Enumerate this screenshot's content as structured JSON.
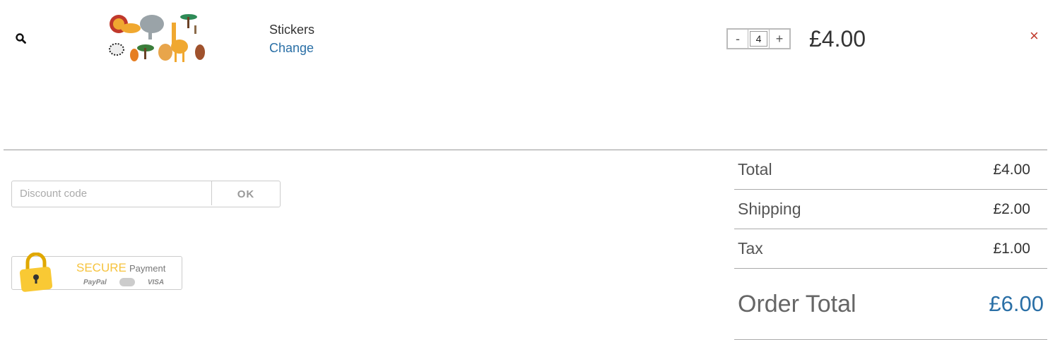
{
  "cart_item": {
    "name": "Stickers",
    "change_label": "Change",
    "quantity": "4",
    "minus_label": "-",
    "plus_label": "+",
    "price": "£4.00",
    "remove_label": "×"
  },
  "discount": {
    "placeholder": "Discount code",
    "value": "",
    "button_label": "OK"
  },
  "secure_badge": {
    "word1": "SECURE",
    "word2": "Payment",
    "brands": [
      "PayPal",
      "VISA"
    ]
  },
  "totals": {
    "rows": [
      {
        "label": "Total",
        "amount": "£4.00"
      },
      {
        "label": "Shipping",
        "amount": "£2.00"
      },
      {
        "label": "Tax",
        "amount": "£1.00"
      }
    ],
    "grand": {
      "label": "Order Total",
      "amount": "£6.00"
    }
  },
  "colors": {
    "accent": "#2a6fa6",
    "remove": "#c0392b",
    "secure_yellow": "#f6c33d"
  },
  "icons": [
    "search-icon",
    "close-icon",
    "padlock-icon",
    "mastercard-icon"
  ]
}
